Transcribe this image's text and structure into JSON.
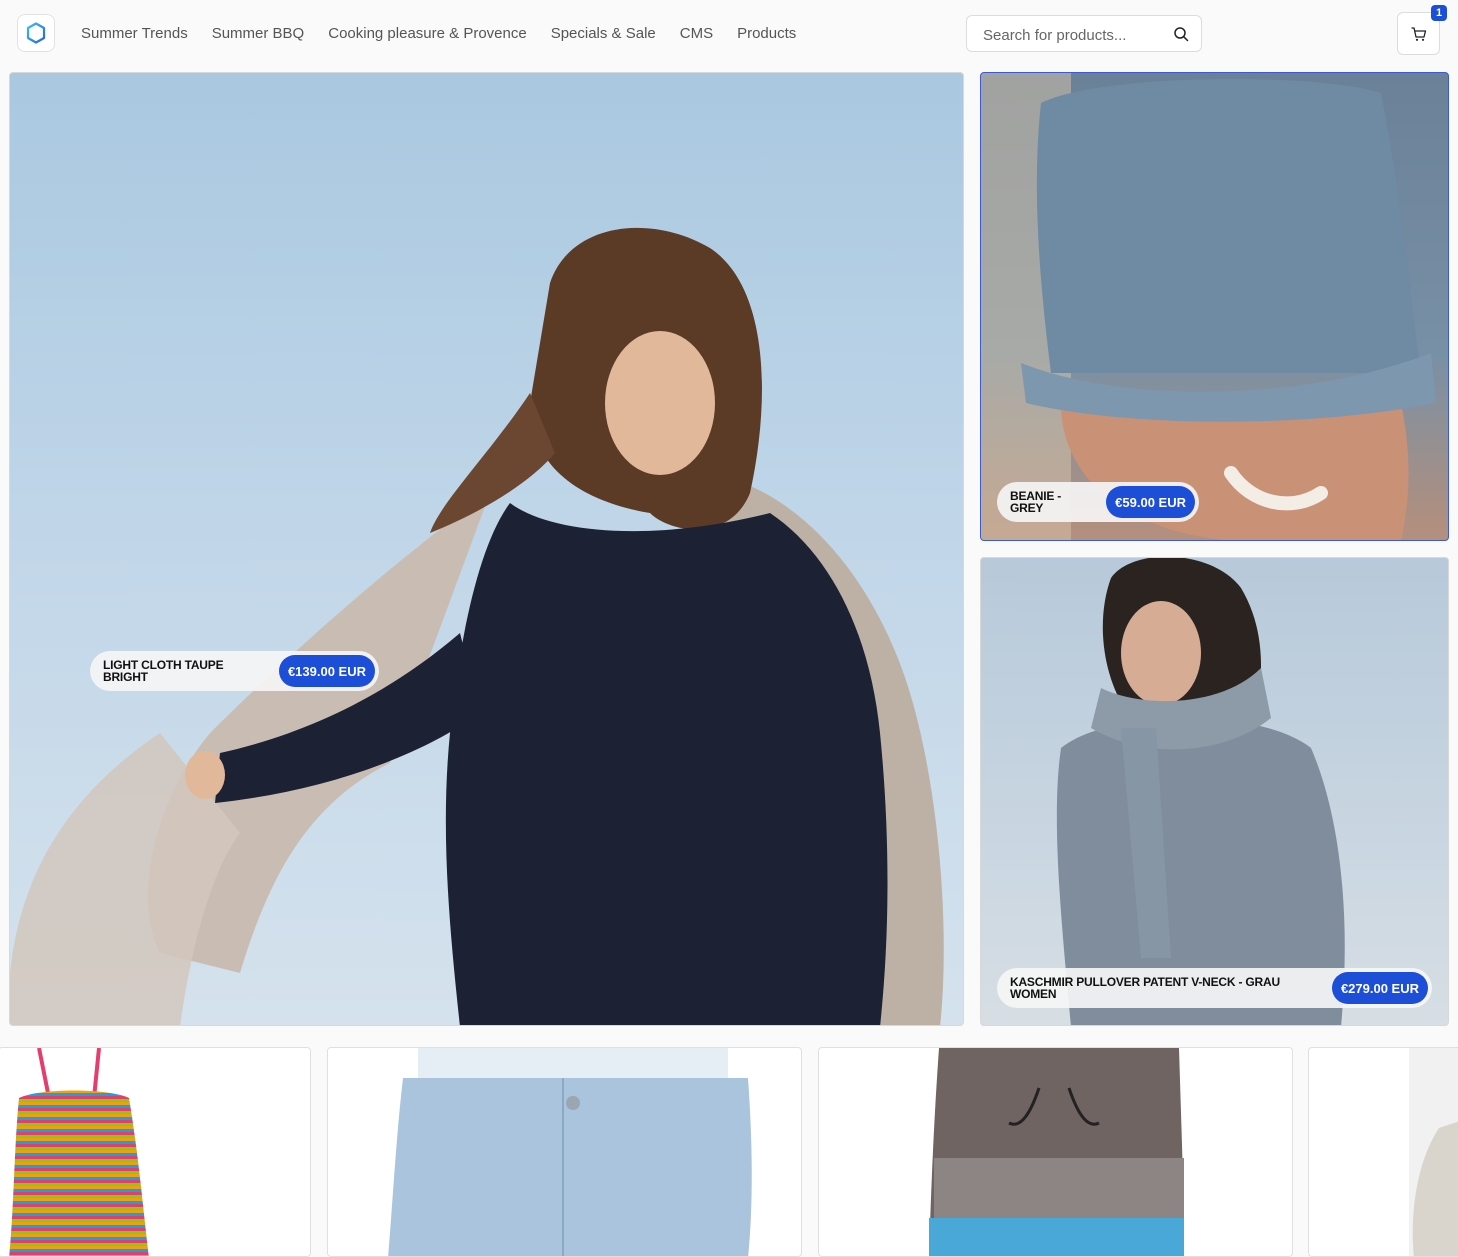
{
  "nav": {
    "items": [
      "Summer Trends",
      "Summer BBQ",
      "Cooking pleasure & Provence",
      "Specials & Sale",
      "CMS",
      "Products"
    ]
  },
  "search": {
    "placeholder": "Search for products..."
  },
  "cart": {
    "count": "1"
  },
  "featured": [
    {
      "name": "LIGHT CLOTH TAUPE BRIGHT",
      "price": "€139.00 EUR"
    },
    {
      "name": "BEANIE - GREY",
      "price": "€59.00 EUR"
    },
    {
      "name": "KASCHMIR PULLOVER PATENT V-NECK - GRAU WOMEN",
      "price": "€279.00 EUR"
    }
  ],
  "colors": {
    "accent": "#1d4ed8"
  }
}
